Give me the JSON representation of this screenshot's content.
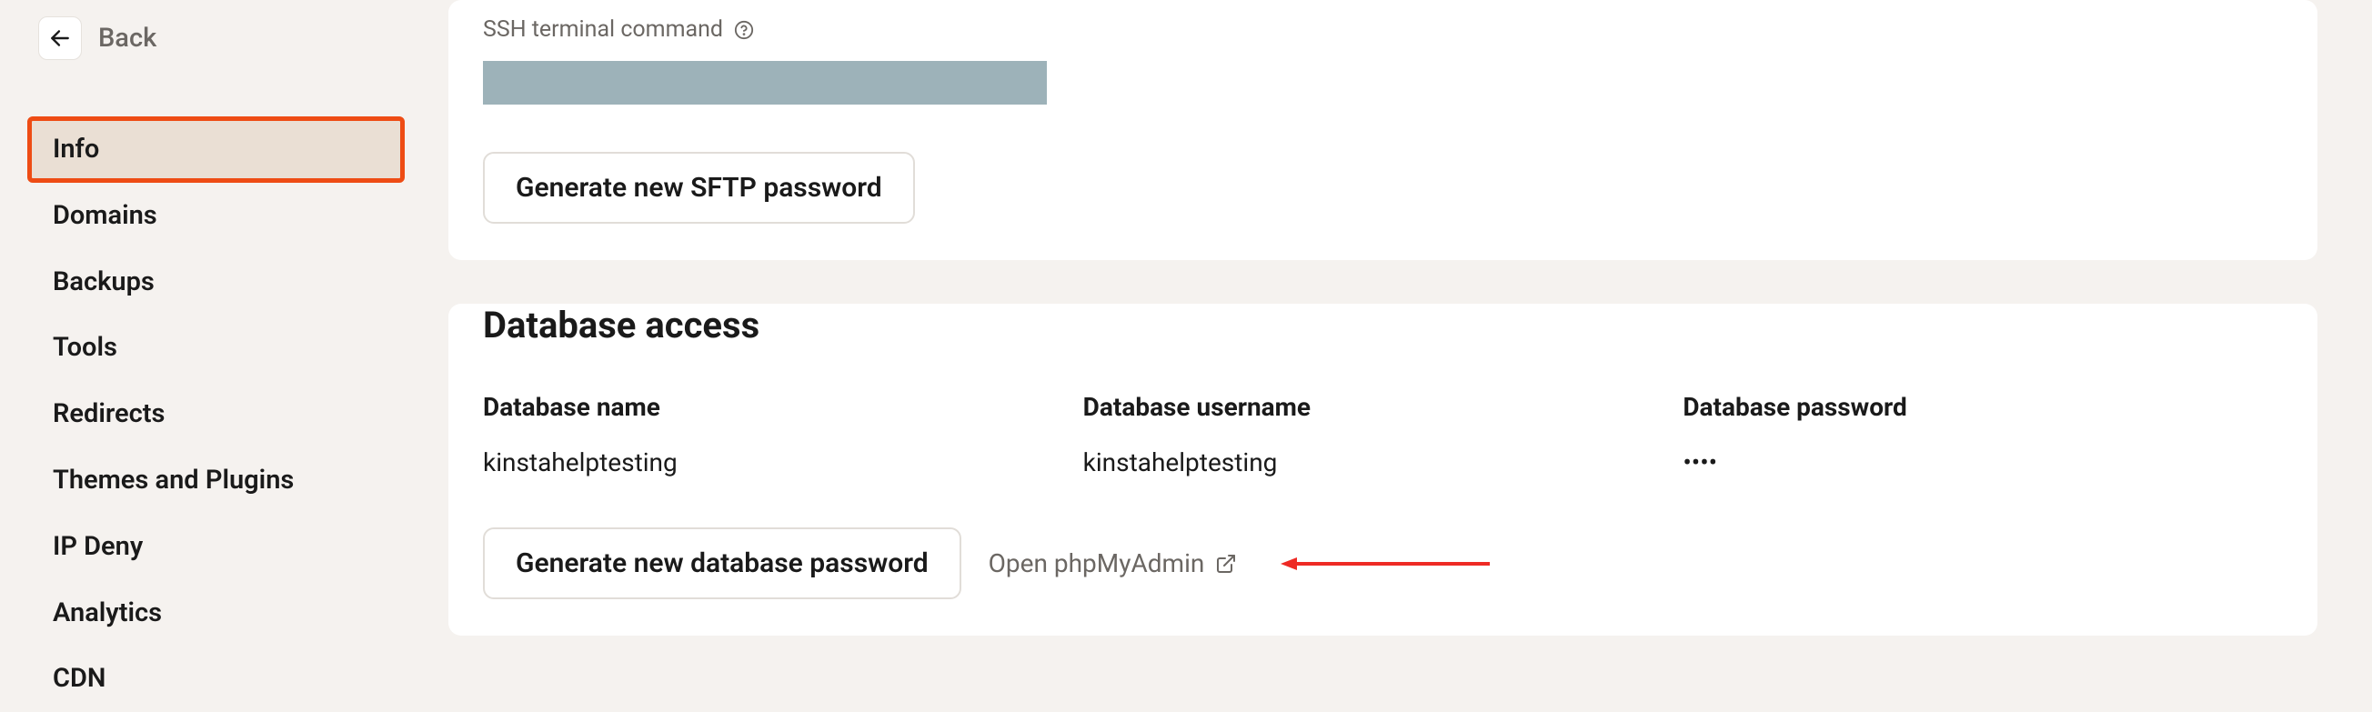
{
  "back": {
    "label": "Back"
  },
  "sidebar": {
    "items": [
      {
        "label": "Info"
      },
      {
        "label": "Domains"
      },
      {
        "label": "Backups"
      },
      {
        "label": "Tools"
      },
      {
        "label": "Redirects"
      },
      {
        "label": "Themes and Plugins"
      },
      {
        "label": "IP Deny"
      },
      {
        "label": "Analytics"
      },
      {
        "label": "CDN"
      }
    ],
    "active_index": 0
  },
  "ssh": {
    "label": "SSH terminal command",
    "generate_button": "Generate new SFTP password"
  },
  "database": {
    "title": "Database access",
    "name_label": "Database name",
    "name_value": "kinstahelptesting",
    "username_label": "Database username",
    "username_value": "kinstahelptesting",
    "password_label": "Database password",
    "password_value": "••••",
    "generate_button": "Generate new database password",
    "open_link": "Open phpMyAdmin"
  }
}
